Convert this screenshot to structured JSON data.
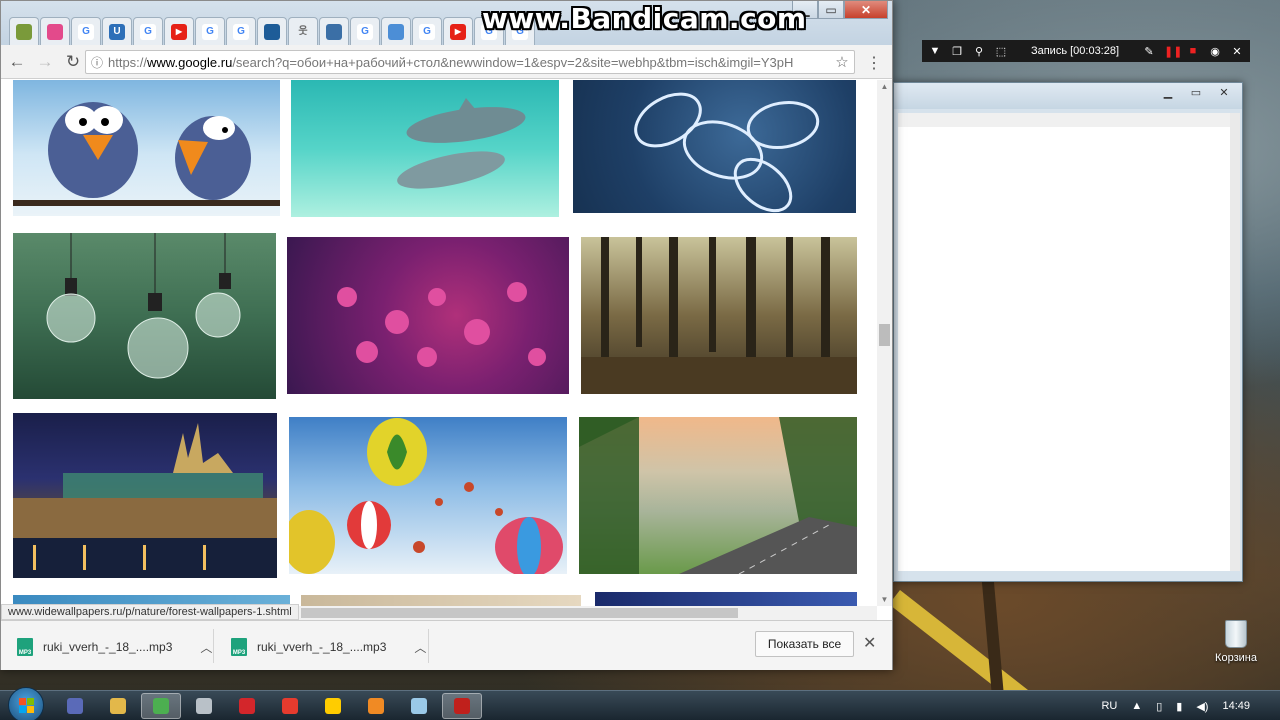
{
  "watermark": "www.Bandicam.com",
  "bandicam": {
    "status": "Запись [00:03:28]"
  },
  "desktop": {
    "recycle_label": "Корзина"
  },
  "chrome": {
    "tabs": [
      {
        "icon": "generic",
        "color": "#7a9a3a"
      },
      {
        "icon": "generic",
        "color": "#e34a8b"
      },
      {
        "icon": "google",
        "color": "#4285f4"
      },
      {
        "icon": "u",
        "color": "#2d6fb8"
      },
      {
        "icon": "google",
        "color": "#4285f4"
      },
      {
        "icon": "youtube",
        "color": "#e62117"
      },
      {
        "icon": "google",
        "color": "#4285f4"
      },
      {
        "icon": "google",
        "color": "#4285f4"
      },
      {
        "icon": "generic",
        "color": "#1d5c98"
      },
      {
        "icon": "person",
        "color": "#6a6a6a"
      },
      {
        "icon": "generic",
        "color": "#3b6fa6"
      },
      {
        "icon": "google",
        "color": "#4285f4"
      },
      {
        "icon": "generic",
        "color": "#4c8ed6"
      },
      {
        "icon": "google",
        "color": "#4285f4"
      },
      {
        "icon": "youtube",
        "color": "#e62117"
      },
      {
        "icon": "google",
        "color": "#4285f4"
      },
      {
        "icon": "google",
        "color": "#4285f4"
      }
    ],
    "url_prefix": "https://",
    "url_domain": "www.google.ru",
    "url_rest": "/search?q=обои+на+рабочий+стол&newwindow=1&espv=2&site=webhp&tbm=isch&imgil=Y3pH",
    "status_url": "www.widewallpapers.ru/p/nature/forest-wallpapers-1.shtml"
  },
  "images": [
    {
      "name": "image-birds",
      "desc": "cartoon birds"
    },
    {
      "name": "image-dolphins",
      "desc": "dolphins"
    },
    {
      "name": "image-frost-leaves",
      "desc": "frosted leaves"
    },
    {
      "name": "image-light-bulbs",
      "desc": "light bulbs"
    },
    {
      "name": "image-pink-flowers",
      "desc": "pink flowers"
    },
    {
      "name": "image-forest",
      "desc": "forest"
    },
    {
      "name": "image-prague-night",
      "desc": "night city"
    },
    {
      "name": "image-balloons",
      "desc": "hot air balloons"
    },
    {
      "name": "image-foggy-road",
      "desc": "foggy road"
    }
  ],
  "downloads": [
    {
      "file": "ruki_vverh_-_18_....mp3"
    },
    {
      "file": "ruki_vverh_-_18_....mp3"
    }
  ],
  "shelf": {
    "show_all": "Показать все"
  },
  "taskbar": {
    "lang": "RU",
    "time": "14:49",
    "items": [
      {
        "name": "taskbar-media-icon",
        "color": "#5a6ab8"
      },
      {
        "name": "taskbar-explorer-icon",
        "color": "#e3b84a"
      },
      {
        "name": "taskbar-chrome-icon",
        "color": "#4caf50",
        "active": true
      },
      {
        "name": "taskbar-calculator-icon",
        "color": "#b9c1c8"
      },
      {
        "name": "taskbar-opera-icon",
        "color": "#d3262b"
      },
      {
        "name": "taskbar-yandex-icon",
        "color": "#e63b2e"
      },
      {
        "name": "taskbar-yandex-browser-icon",
        "color": "#ffcc00"
      },
      {
        "name": "taskbar-firefox-icon",
        "color": "#f08a24"
      },
      {
        "name": "taskbar-notepad-icon",
        "color": "#9ac9e8"
      },
      {
        "name": "taskbar-bandicam-icon",
        "color": "#c0201c",
        "active": true
      }
    ]
  }
}
